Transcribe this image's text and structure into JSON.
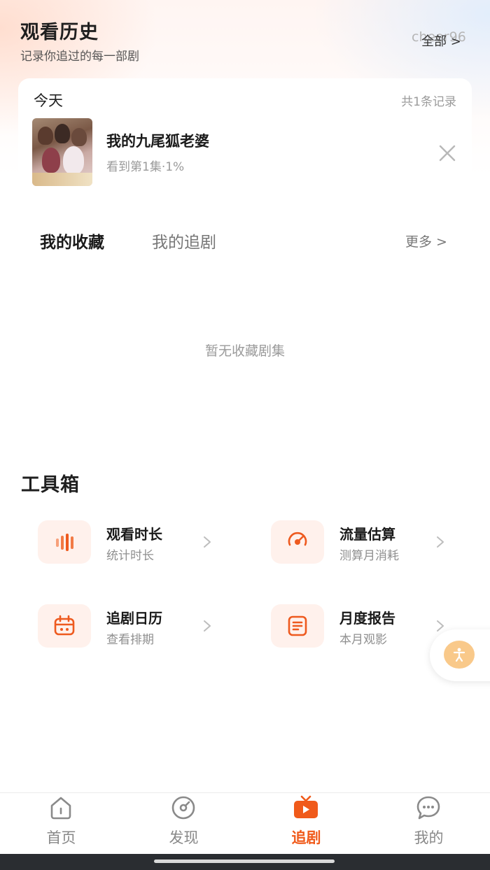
{
  "history": {
    "title": "观看历史",
    "subtitle": "记录你追过的每一部剧",
    "overlay_text": "cheer96",
    "all_link": "全部 >",
    "today_label": "今天",
    "record_count": "共1条记录",
    "item": {
      "name": "我的九尾狐老婆",
      "progress": "看到第1集·1%"
    }
  },
  "collection": {
    "tabs": [
      "我的收藏",
      "我的追剧"
    ],
    "active_tab": 0,
    "more_link": "更多 >",
    "empty_text": "暂无收藏剧集"
  },
  "toolbox": {
    "title": "工具箱",
    "tools": [
      {
        "name": "观看时长",
        "desc": "统计时长",
        "icon": "bar-stats-icon"
      },
      {
        "name": "流量估算",
        "desc": "测算月消耗",
        "icon": "gauge-icon"
      },
      {
        "name": "追剧日历",
        "desc": "查看排期",
        "icon": "calendar-icon"
      },
      {
        "name": "月度报告",
        "desc": "本月观影",
        "icon": "report-icon"
      }
    ]
  },
  "bottom_nav": {
    "items": [
      {
        "label": "首页",
        "icon": "home-icon"
      },
      {
        "label": "发现",
        "icon": "discover-icon"
      },
      {
        "label": "追剧",
        "icon": "tv-icon"
      },
      {
        "label": "我的",
        "icon": "chat-bubble-icon"
      }
    ],
    "active_index": 2
  },
  "colors": {
    "accent": "#f05a1a",
    "icon_bg": "#fff1ec",
    "float_button": "#f9c98a"
  }
}
